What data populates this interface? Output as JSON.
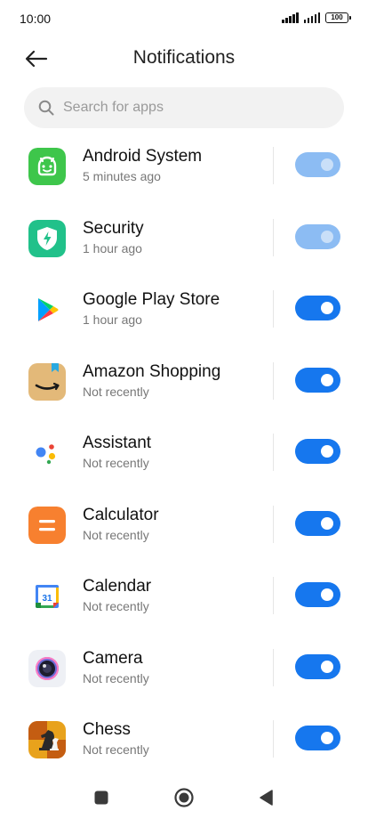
{
  "status": {
    "time": "10:00",
    "battery": "100"
  },
  "header": {
    "title": "Notifications"
  },
  "search": {
    "placeholder": "Search for apps"
  },
  "apps": [
    {
      "name": "Android System",
      "subtitle": "5 minutes ago",
      "enabled": true,
      "editable": false,
      "icon": "android-system-icon"
    },
    {
      "name": "Security",
      "subtitle": "1 hour ago",
      "enabled": true,
      "editable": false,
      "icon": "security-icon"
    },
    {
      "name": "Google Play Store",
      "subtitle": "1 hour ago",
      "enabled": true,
      "editable": true,
      "icon": "google-play-store-icon"
    },
    {
      "name": "Amazon Shopping",
      "subtitle": "Not recently",
      "enabled": true,
      "editable": true,
      "icon": "amazon-shopping-icon"
    },
    {
      "name": "Assistant",
      "subtitle": "Not recently",
      "enabled": true,
      "editable": true,
      "icon": "assistant-icon"
    },
    {
      "name": "Calculator",
      "subtitle": "Not recently",
      "enabled": true,
      "editable": true,
      "icon": "calculator-icon"
    },
    {
      "name": "Calendar",
      "subtitle": "Not recently",
      "enabled": true,
      "editable": true,
      "icon": "calendar-icon",
      "icon_text": "31"
    },
    {
      "name": "Camera",
      "subtitle": "Not recently",
      "enabled": true,
      "editable": true,
      "icon": "camera-icon"
    },
    {
      "name": "Chess",
      "subtitle": "Not recently",
      "enabled": true,
      "editable": true,
      "icon": "chess-icon"
    }
  ],
  "colors": {
    "toggle_on": "#1677ee",
    "toggle_disabled": "#8cbcf3",
    "search_bg": "#f2f2f2"
  }
}
